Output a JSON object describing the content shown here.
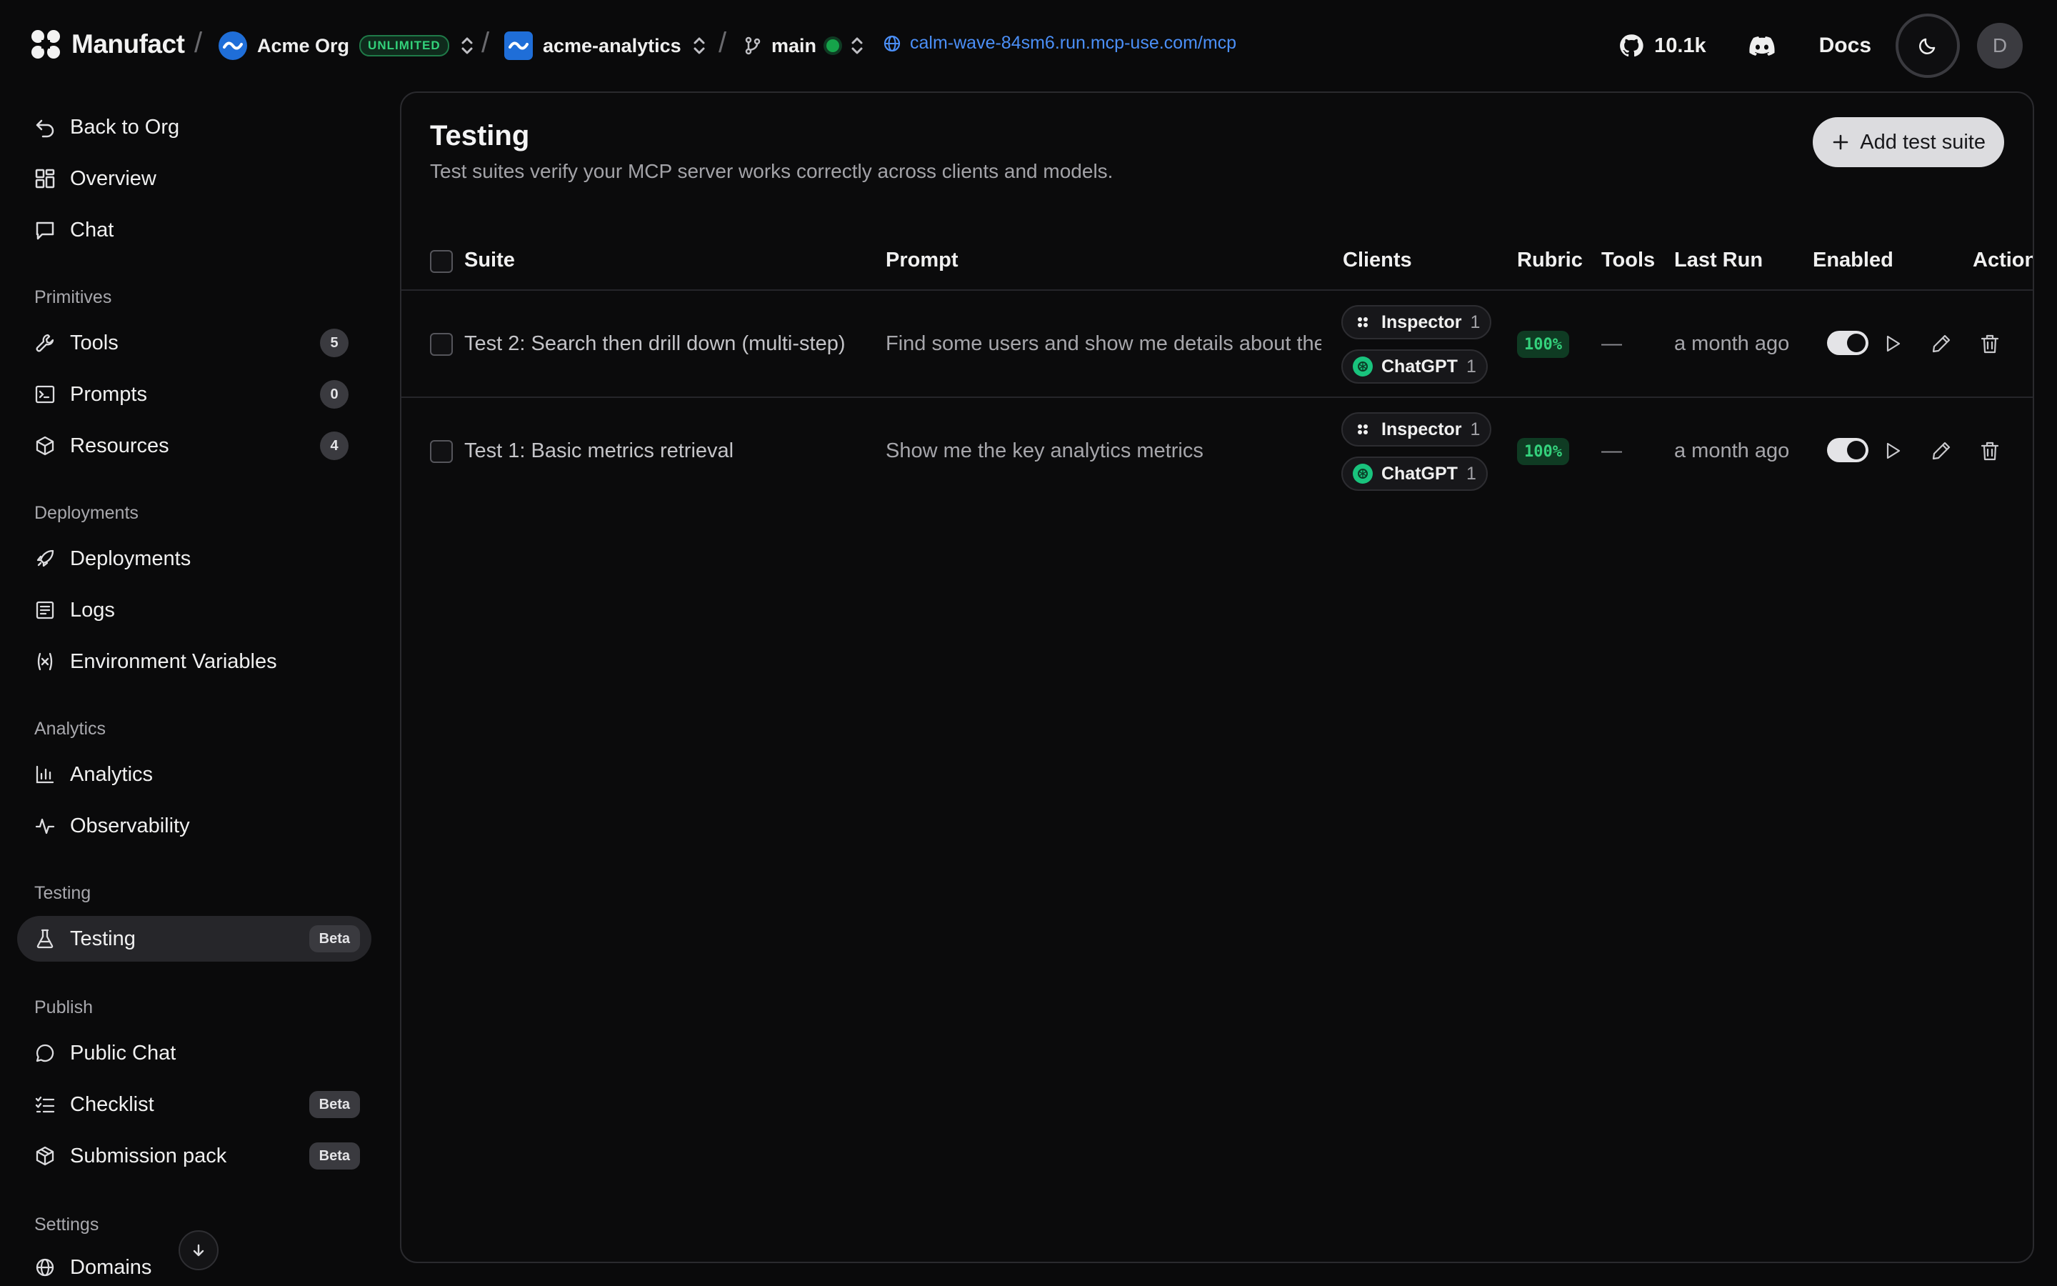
{
  "topbar": {
    "brand": "Manufact",
    "org_name": "Acme Org",
    "org_plan": "UNLIMITED",
    "repo_name": "acme-analytics",
    "branch": "main",
    "url": "calm-wave-84sm6.run.mcp-use.com/mcp",
    "github_stars": "10.1k",
    "docs_label": "Docs",
    "avatar_initial": "D",
    "separator": "/"
  },
  "sidebar": {
    "top_items": [
      {
        "label": "Back to Org",
        "icon": "undo-arrow-icon"
      },
      {
        "label": "Overview",
        "icon": "grid-icon"
      },
      {
        "label": "Chat",
        "icon": "chat-bubble-icon"
      }
    ],
    "sections": [
      {
        "title": "Primitives",
        "items": [
          {
            "label": "Tools",
            "icon": "wrench-icon",
            "count": "5"
          },
          {
            "label": "Prompts",
            "icon": "terminal-icon",
            "count": "0"
          },
          {
            "label": "Resources",
            "icon": "box-icon",
            "count": "4"
          }
        ]
      },
      {
        "title": "Deployments",
        "items": [
          {
            "label": "Deployments",
            "icon": "rocket-icon"
          },
          {
            "label": "Logs",
            "icon": "logs-icon"
          },
          {
            "label": "Environment Variables",
            "icon": "variable-icon"
          }
        ]
      },
      {
        "title": "Analytics",
        "items": [
          {
            "label": "Analytics",
            "icon": "bar-chart-icon"
          },
          {
            "label": "Observability",
            "icon": "activity-icon"
          }
        ]
      },
      {
        "title": "Testing",
        "items": [
          {
            "label": "Testing",
            "icon": "flask-icon",
            "badge": "Beta",
            "active": true
          }
        ]
      },
      {
        "title": "Publish",
        "items": [
          {
            "label": "Public Chat",
            "icon": "message-circle-icon"
          },
          {
            "label": "Checklist",
            "icon": "list-checks-icon",
            "badge": "Beta"
          },
          {
            "label": "Submission pack",
            "icon": "package-icon",
            "badge": "Beta"
          }
        ]
      },
      {
        "title": "Settings",
        "items": [
          {
            "label": "Domains",
            "icon": "globe-icon"
          }
        ]
      }
    ]
  },
  "main": {
    "title": "Testing",
    "subtitle": "Test suites verify your MCP server works correctly across clients and models.",
    "add_button_label": "Add test suite",
    "columns": {
      "suite": "Suite",
      "prompt": "Prompt",
      "clients": "Clients",
      "rubric": "Rubric",
      "tools": "Tools",
      "last_run": "Last Run",
      "enabled": "Enabled",
      "actions": "Actions"
    },
    "rows": [
      {
        "suite": "Test 2: Search then drill down (multi-step)",
        "prompt": "Find some users and show me details about the",
        "clients": [
          {
            "name": "Inspector",
            "count": "1",
            "icon": "inspector-icon"
          },
          {
            "name": "ChatGPT",
            "count": "1",
            "icon": "openai-icon"
          }
        ],
        "rubric": "100%",
        "tools": "—",
        "last_run": "a month ago",
        "enabled": true
      },
      {
        "suite": "Test 1: Basic metrics retrieval",
        "prompt": "Show me the key analytics metrics",
        "clients": [
          {
            "name": "Inspector",
            "count": "1",
            "icon": "inspector-icon"
          },
          {
            "name": "ChatGPT",
            "count": "1",
            "icon": "openai-icon"
          }
        ],
        "rubric": "100%",
        "tools": "—",
        "last_run": "a month ago",
        "enabled": true
      }
    ]
  },
  "colors": {
    "background": "#0a0a0b",
    "accent_blue": "#1f6ed8",
    "link_blue": "#4b8ff7",
    "success_green": "#34d17c"
  }
}
